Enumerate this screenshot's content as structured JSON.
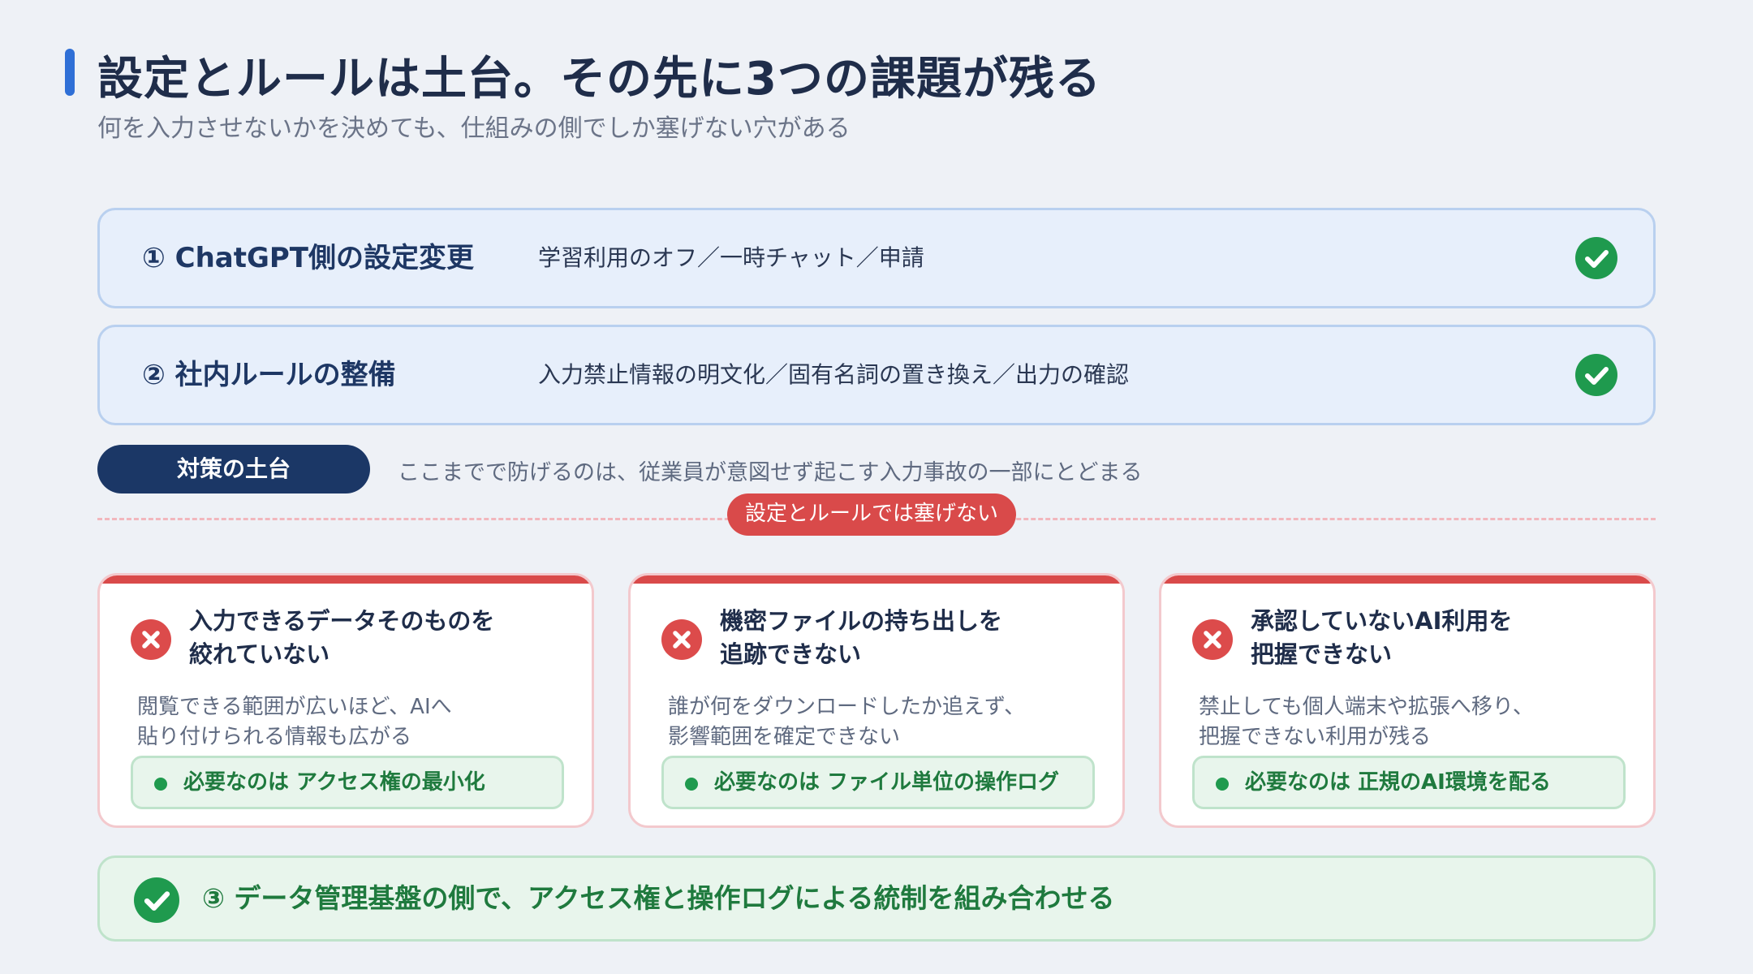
{
  "header": {
    "title": "設定とルールは土台。その先に3つの課題が残る",
    "subtitle": "何を入力させないかを決めても、仕組みの側でしか塞げない穴がある"
  },
  "steps": [
    {
      "label": "① ChatGPT側の設定変更",
      "desc": "学習利用のオフ／一時チャット／申請",
      "status_icon": "check-icon"
    },
    {
      "label": "② 社内ルールの整備",
      "desc": "入力禁止情報の明文化／固有名詞の置き換え／出力の確認",
      "status_icon": "check-icon"
    }
  ],
  "base": {
    "pill": "対策の土台",
    "note": "ここまでで防げるのは、従業員が意図せず起こす入力事故の一部にとどまる"
  },
  "divider": {
    "tag": "設定とルールでは塞げない"
  },
  "issues": [
    {
      "title": "入力できるデータそのものを\n絞れていない",
      "body": "閲覧できる範囲が広いほど、AIへ\n貼り付けられる情報も広がる",
      "need": "必要なのは アクセス権の最小化"
    },
    {
      "title": "機密ファイルの持ち出しを\n追跡できない",
      "body": "誰が何をダウンロードしたか追えず、\n影響範囲を確定できない",
      "need": "必要なのは ファイル単位の操作ログ"
    },
    {
      "title": "承認していないAI利用を\n把握できない",
      "body": "禁止しても個人端末や拡張へ移り、\n把握できない利用が残る",
      "need": "必要なのは 正規のAI環境を配る"
    }
  ],
  "final": {
    "text": "③ データ管理基盤の側で、アクセス権と操作ログによる統制を組み合わせる"
  },
  "colors": {
    "accent_blue": "#2f6fd6",
    "navy": "#1b3766",
    "success_green": "#1f9a4e",
    "danger_red": "#d94a4a"
  }
}
